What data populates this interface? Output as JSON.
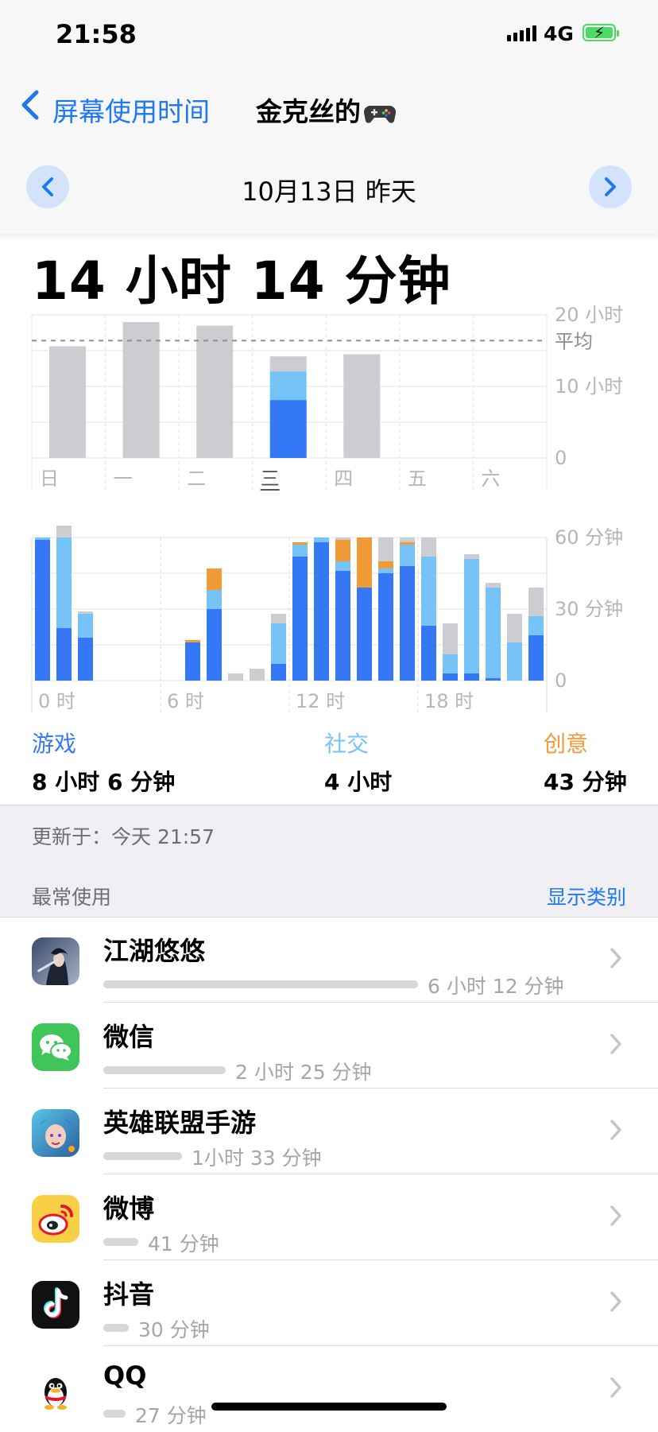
{
  "status": {
    "time": "21:58",
    "network": "4G"
  },
  "nav": {
    "back_label": "屏幕使用时间",
    "title": "金克丝的",
    "title_emoji": "game-controller"
  },
  "date": {
    "label": "10月13日 昨天"
  },
  "total": "14 小时 14 分钟",
  "chart_data": [
    {
      "type": "bar",
      "categories": [
        "日",
        "一",
        "二",
        "三",
        "四",
        "五",
        "六"
      ],
      "series": [
        {
          "name": "游戏",
          "color": "#3478f6",
          "values": [
            null,
            null,
            null,
            8.1,
            null,
            null,
            null
          ]
        },
        {
          "name": "社交",
          "color": "#76c4f7",
          "values": [
            null,
            null,
            null,
            4.0,
            null,
            null,
            null
          ]
        },
        {
          "name": "其他",
          "color": "#cdcdd1",
          "values": [
            15.6,
            19.0,
            18.5,
            2.1,
            14.5,
            0,
            0
          ]
        }
      ],
      "highlight_category": "三",
      "average": 16.4,
      "average_label": "平均",
      "y_ticks": [
        "0",
        "10 小时",
        "20 小时"
      ],
      "ylim": [
        0,
        20
      ]
    },
    {
      "type": "bar",
      "stacked": true,
      "x": [
        0,
        1,
        2,
        3,
        4,
        5,
        6,
        7,
        8,
        9,
        10,
        11,
        12,
        13,
        14,
        15,
        16,
        17,
        18,
        19,
        20,
        21,
        22,
        23
      ],
      "x_ticks": [
        "0 时",
        "6 时",
        "12 时",
        "18 时"
      ],
      "y_ticks": [
        "0",
        "30 分钟",
        "60 分钟"
      ],
      "ylim": [
        0,
        60
      ],
      "series": [
        {
          "name": "游戏",
          "color": "#3478f6",
          "values": [
            59,
            22,
            18,
            0,
            0,
            0,
            0,
            16,
            30,
            0,
            0,
            7,
            52,
            58,
            46,
            39,
            45,
            48,
            23,
            3,
            3,
            1,
            0,
            19
          ]
        },
        {
          "name": "社交",
          "color": "#76c4f7",
          "values": [
            1,
            38,
            10,
            0,
            0,
            0,
            0,
            0,
            8,
            0,
            0,
            17,
            5,
            2,
            4,
            0,
            2,
            9,
            29,
            8,
            48,
            38,
            16,
            8
          ]
        },
        {
          "name": "创意",
          "color": "#f19a38",
          "values": [
            0,
            0,
            0,
            0,
            0,
            0,
            0,
            1,
            9,
            0,
            0,
            0,
            1,
            0,
            9,
            21,
            3,
            1,
            0,
            0,
            0,
            0,
            0,
            0
          ]
        },
        {
          "name": "其他",
          "color": "#cdcdd1",
          "values": [
            0,
            5,
            1,
            0,
            0,
            0,
            0,
            0,
            0,
            3,
            5,
            4,
            0,
            0,
            1,
            0,
            10,
            2,
            8,
            13,
            2,
            2,
            12,
            12
          ]
        }
      ]
    }
  ],
  "legend": [
    {
      "category": "游戏",
      "value": "8 小时 6 分钟",
      "color": "#3478f6"
    },
    {
      "category": "社交",
      "value": "4 小时",
      "color": "#76c4f7"
    },
    {
      "category": "创意",
      "value": "43 分钟",
      "color": "#f19a38"
    }
  ],
  "updated": "更新于：今天 21:57",
  "most_used_header": "最常使用",
  "show_categories": "显示类别",
  "apps": [
    {
      "name": "江湖悠悠",
      "duration": "6 小时 12 分钟",
      "fraction": 1.0,
      "icon": "jianghu-app-icon"
    },
    {
      "name": "微信",
      "duration": "2 小时 25 分钟",
      "fraction": 0.39,
      "icon": "wechat-app-icon"
    },
    {
      "name": "英雄联盟手游",
      "duration": "1小时 33 分钟",
      "fraction": 0.25,
      "icon": "lol-app-icon"
    },
    {
      "name": "微博",
      "duration": "41 分钟",
      "fraction": 0.11,
      "icon": "weibo-app-icon"
    },
    {
      "name": "抖音",
      "duration": "30 分钟",
      "fraction": 0.08,
      "icon": "douyin-app-icon"
    },
    {
      "name": "QQ",
      "duration": "27 分钟",
      "fraction": 0.07,
      "icon": "qq-app-icon"
    }
  ]
}
